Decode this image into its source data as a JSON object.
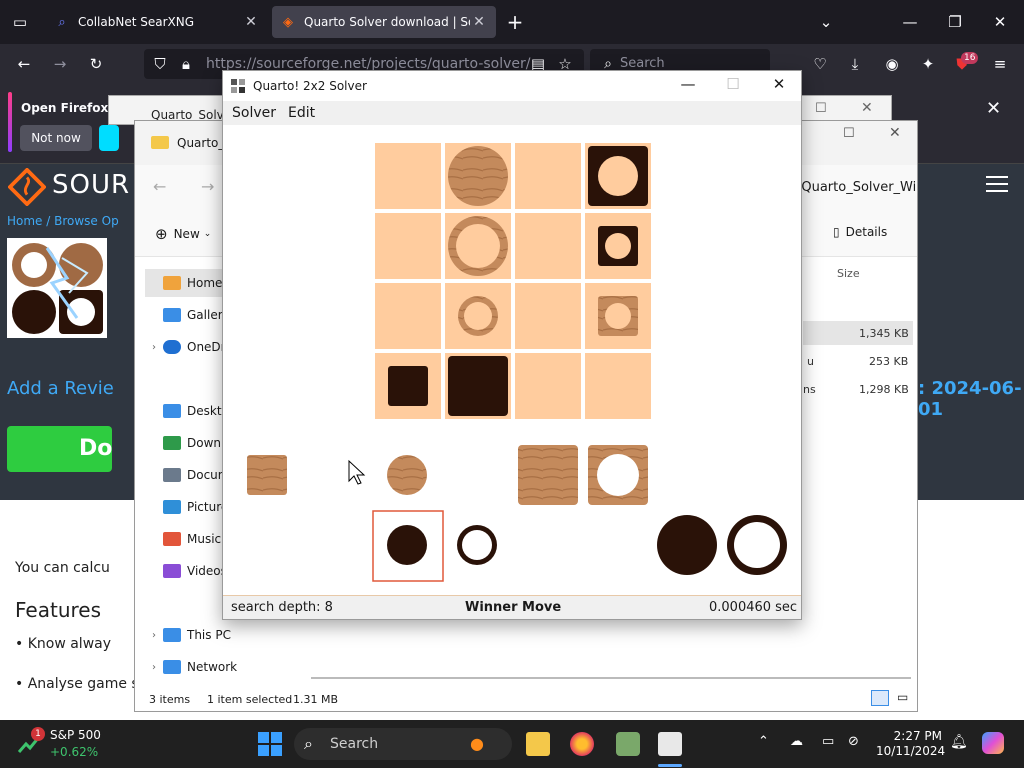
{
  "browser": {
    "tabs": [
      {
        "label": "CollabNet SearXNG",
        "active": false
      },
      {
        "label": "Quarto Solver download | Sourc",
        "active": true
      }
    ],
    "url": "https://sourceforge.net/projects/quarto-solver/",
    "search_placeholder": "Search",
    "extension_badge": "16",
    "notice": {
      "title": "Open Firefox ev",
      "not_now": "Not now"
    }
  },
  "sourceforge": {
    "brand": "SOUR",
    "breadcrumb": "Home / Browse Op",
    "add_review": "Add a Revie",
    "download_label": "Do",
    "updated_date": ": 2024-06-01",
    "text_calc": "You can calcu",
    "features": "Features",
    "bullet1": "• Know alway",
    "bullet2": "• Analyse game s",
    "items_count_partial": "3 i"
  },
  "background_windows": {
    "quarto_title": "Quarto_Solve",
    "explorer_title": "Quarto_",
    "explorer_heading": "n Quarto_Solver_Wi",
    "new_label": "New",
    "details_label": "Details",
    "size_header": "Size",
    "sidebar": [
      {
        "label": "Home",
        "icon": "home-icon",
        "color": "#f0a33c",
        "selected": true
      },
      {
        "label": "Gallery",
        "icon": "gallery-icon",
        "color": "#3a8ee6",
        "selected": false
      },
      {
        "label": "OneDrive",
        "icon": "cloud-icon",
        "color": "#1f6fd1",
        "selected": false
      },
      {
        "label": "Desktop",
        "icon": "desktop-icon",
        "color": "#3a8ee6",
        "selected": false
      },
      {
        "label": "Downloads",
        "icon": "download-icon",
        "color": "#2e9a4a",
        "selected": false
      },
      {
        "label": "Documents",
        "icon": "document-icon",
        "color": "#6b7a8c",
        "selected": false
      },
      {
        "label": "Pictures",
        "icon": "pictures-icon",
        "color": "#2f8fd8",
        "selected": false
      },
      {
        "label": "Music",
        "icon": "music-icon",
        "color": "#e2553a",
        "selected": false
      },
      {
        "label": "Videos",
        "icon": "video-icon",
        "color": "#8a4dd6",
        "selected": false
      },
      {
        "label": "This PC",
        "icon": "pc-icon",
        "color": "#3a8ee6",
        "selected": false
      },
      {
        "label": "Network",
        "icon": "network-icon",
        "color": "#3a8ee6",
        "selected": false
      }
    ],
    "files": [
      {
        "size": "1,345 KB",
        "type_partial": ""
      },
      {
        "size": "253 KB",
        "type_partial": "u"
      },
      {
        "size": "1,298 KB",
        "type_partial": "ns"
      }
    ],
    "status": {
      "items": "3 items",
      "selected": "1 item selected",
      "size": "1.31 MB"
    }
  },
  "quarto": {
    "title": "Quarto! 2x2 Solver",
    "menu": [
      "Solver",
      "Edit"
    ],
    "board_colors": {
      "cell": "#ffcc9e",
      "light_piece": "#c48a5c",
      "dark_piece": "#2a1208",
      "highlight": "#e0593a"
    },
    "status": {
      "depth": "search depth: 8",
      "result": "Winner Move",
      "time": "0.000460 sec"
    }
  },
  "taskbar": {
    "stock_name": "S&P 500",
    "stock_change": "+0.62%",
    "stock_badge": "1",
    "search_placeholder": "Search",
    "time": "2:27 PM",
    "date": "10/11/2024"
  }
}
